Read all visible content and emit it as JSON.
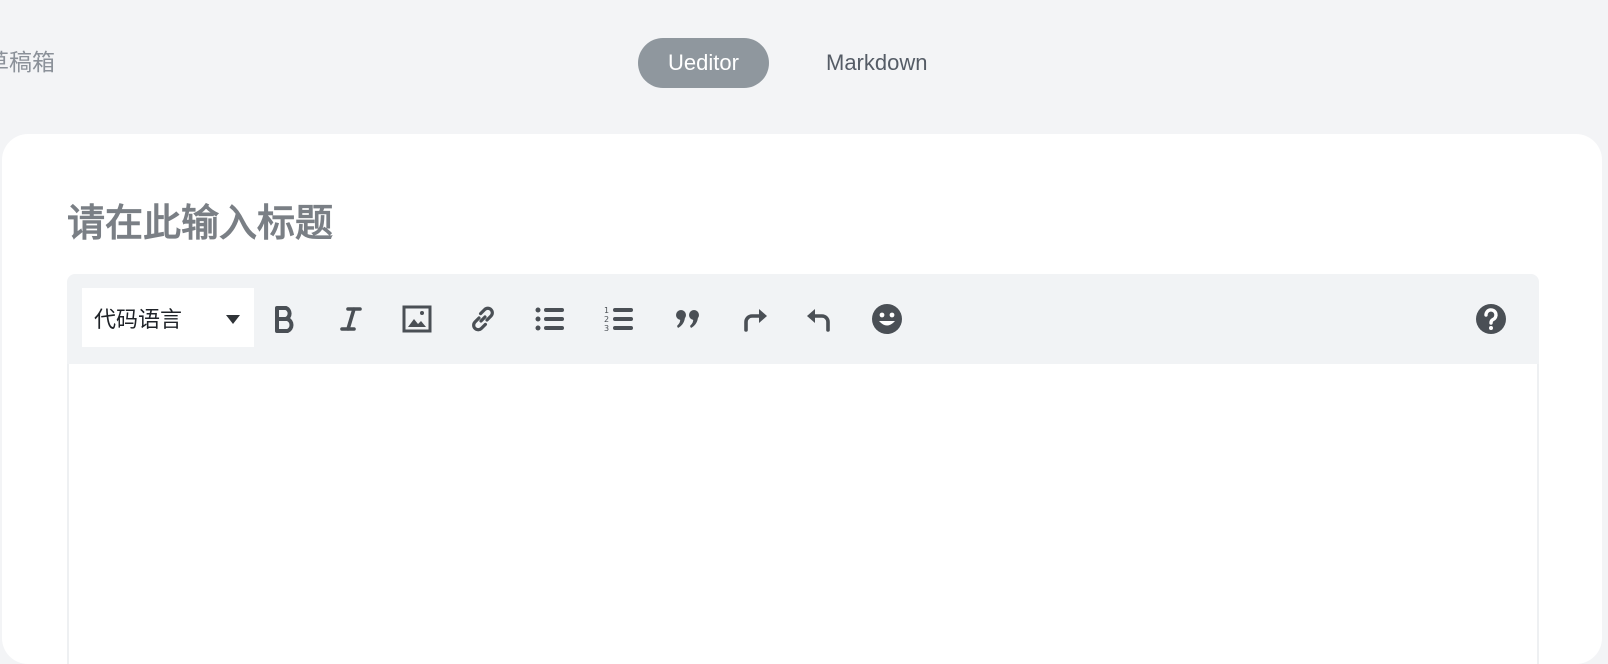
{
  "header": {
    "drafts_label": "草稿箱",
    "modes": [
      {
        "label": "Ueditor",
        "active": true
      },
      {
        "label": "Markdown",
        "active": false
      }
    ]
  },
  "editor": {
    "title_placeholder": "请在此输入标题",
    "title_value": "",
    "code_language_select": {
      "selected": "代码语言"
    },
    "toolbar_icons": [
      "bold-icon",
      "italic-icon",
      "image-icon",
      "link-icon",
      "bullet-list-icon",
      "numbered-list-icon",
      "quote-icon",
      "redo-icon",
      "undo-icon",
      "emoji-icon",
      "help-icon"
    ],
    "body_content": ""
  },
  "colors": {
    "page_bg": "#f3f4f6",
    "active_tab_bg": "#8f979e",
    "toolbar_bg": "#f1f3f5",
    "icon": "#4a4f55"
  }
}
